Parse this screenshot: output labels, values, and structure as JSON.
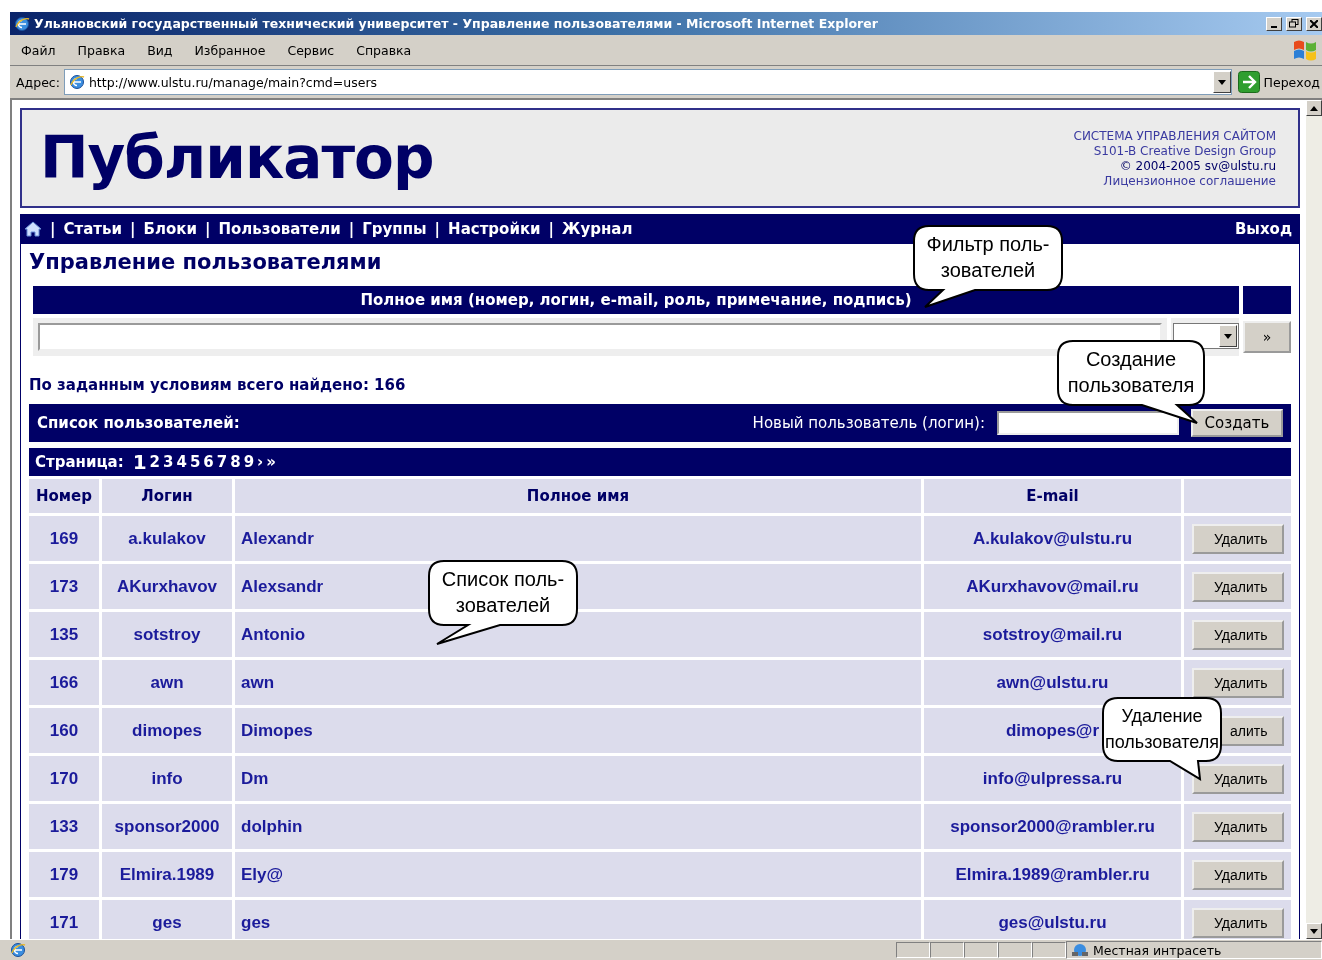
{
  "window": {
    "title": "Ульяновский государственный технический университет - Управление пользователями - Microsoft Internet Explorer"
  },
  "menu": [
    "Файл",
    "Правка",
    "Вид",
    "Избранное",
    "Сервис",
    "Справка"
  ],
  "address": {
    "label": "Адрес:",
    "url": "http://www.ulstu.ru/manage/main?cmd=users",
    "go": "Переход"
  },
  "header": {
    "logo": "Публикатор",
    "info": [
      "СИСТЕМА УПРАВЛЕНИЯ САЙТОМ",
      "S101-B Creative Design Group",
      "**© 2004-2005** sv@ulstu.ru",
      "Лицензионное соглашение"
    ]
  },
  "nav": {
    "separator": "|",
    "items": [
      "Статьи",
      "Блоки",
      "Пользователи",
      "Группы",
      "Настройки",
      "Журнал"
    ],
    "logout": "Выход"
  },
  "heading": "Управление пользователями",
  "filter": {
    "column_header": "Полное имя (номер, логин, e-mail, роль, примечание, подпись)",
    "go": "»"
  },
  "found": "По заданным условиям всего найдено: 166",
  "users_list": {
    "title": "Список пользователей:",
    "new_user_label": "Новый пользователь (логин):",
    "create": "Создать"
  },
  "pagination": {
    "label": "Страница:",
    "pages": [
      {
        "label": "1",
        "selected": true
      },
      {
        "label": "2",
        "selected": false
      },
      {
        "label": "3",
        "selected": false
      },
      {
        "label": "4",
        "selected": false
      },
      {
        "label": "5",
        "selected": false
      },
      {
        "label": "6",
        "selected": false
      },
      {
        "label": "7",
        "selected": false
      },
      {
        "label": "8",
        "selected": false
      },
      {
        "label": "9",
        "selected": false
      }
    ],
    "next": "›",
    "last": "»"
  },
  "table": {
    "columns": [
      "Номер",
      "Логин",
      "Полное имя",
      "E-mail"
    ],
    "rows": [
      {
        "number": "169",
        "login": "a.kulakov",
        "name": "Alexandr",
        "email": "A.kulakov@ulstu.ru",
        "action": "Удалить"
      },
      {
        "number": "173",
        "login": "AKurxhavov",
        "name": "Alexsandr",
        "email": "AKurxhavov@mail.ru",
        "action": "Удалить"
      },
      {
        "number": "135",
        "login": "sotstroy",
        "name": "Antonio",
        "email": "sotstroy@mail.ru",
        "action": "Удалить"
      },
      {
        "number": "166",
        "login": "awn",
        "name": "awn",
        "email": "awn@ulstu.ru",
        "action": "Удалить"
      },
      {
        "number": "160",
        "login": "dimopes",
        "name": "Dimopes",
        "email": "dimopes@r",
        "action": "алить"
      },
      {
        "number": "170",
        "login": "info",
        "name": "Dm",
        "email": "info@ulpressa.ru",
        "action": "Удалить"
      },
      {
        "number": "133",
        "login": "sponsor2000",
        "name": "dolphin",
        "email": "sponsor2000@rambler.ru",
        "action": "Удалить"
      },
      {
        "number": "179",
        "login": "Elmira.1989",
        "name": "Ely@",
        "email": "Elmira.1989@rambler.ru",
        "action": "Удалить"
      },
      {
        "number": "171",
        "login": "ges",
        "name": "ges",
        "email": "ges@ulstu.ru",
        "action": "Удалить"
      }
    ]
  },
  "callouts": [
    "Фильтр поль-\nзователей",
    "Создание\nпользователя",
    "Список поль-\nзователей",
    "Удаление\nпользователя"
  ],
  "status_bar": {
    "zone": "Местная интрасеть"
  }
}
